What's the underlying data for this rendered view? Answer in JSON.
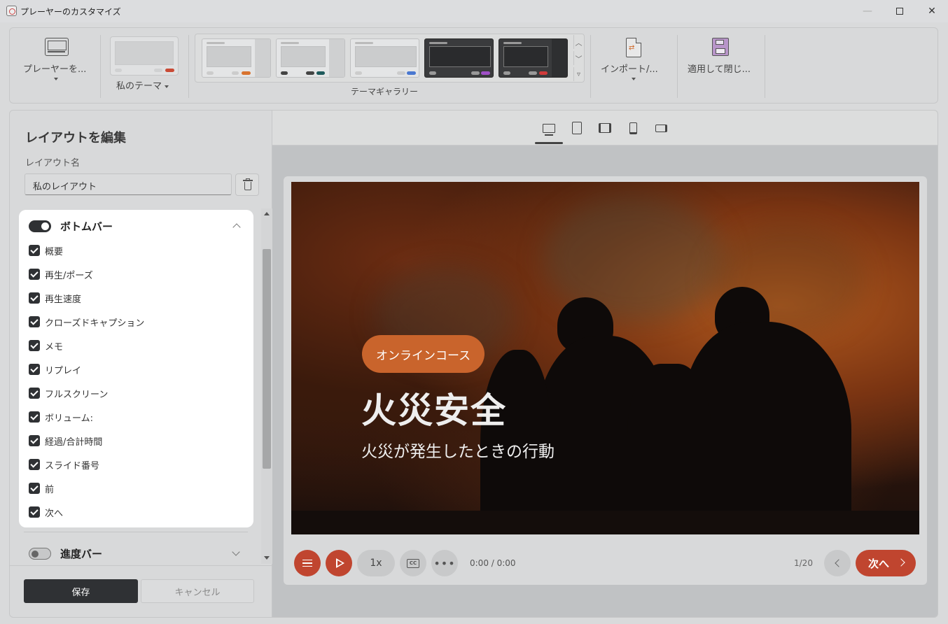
{
  "window": {
    "title": "プレーヤーのカスタマイズ"
  },
  "ribbon": {
    "player_label": "プレーヤーを...",
    "my_theme_label": "私のテーマ",
    "gallery_label": "テーマギャラリー",
    "import_label": "インポート/...",
    "apply_close_label": "適用して閉じ..."
  },
  "left_panel": {
    "title": "レイアウトを編集",
    "layout_name_label": "レイアウト名",
    "layout_name_value": "私のレイアウト",
    "bottom_bar": {
      "title": "ボトムバー",
      "enabled": true,
      "items": [
        {
          "label": "概要",
          "checked": true
        },
        {
          "label": "再生/ポーズ",
          "checked": true
        },
        {
          "label": "再生速度",
          "checked": true
        },
        {
          "label": "クローズドキャプション",
          "checked": true
        },
        {
          "label": "メモ",
          "checked": true
        },
        {
          "label": "リプレイ",
          "checked": true
        },
        {
          "label": "フルスクリーン",
          "checked": true
        },
        {
          "label": "ボリューム:",
          "checked": true
        },
        {
          "label": "経過/合計時間",
          "checked": true
        },
        {
          "label": "スライド番号",
          "checked": true
        },
        {
          "label": "前",
          "checked": true
        },
        {
          "label": "次へ",
          "checked": true
        }
      ]
    },
    "progress_bar": {
      "title": "進度バー",
      "enabled": false
    },
    "save_label": "保存",
    "cancel_label": "キャンセル"
  },
  "preview": {
    "slide": {
      "tag": "オンラインコース",
      "title": "火災安全",
      "subtitle": "火災が発生したときの行動"
    },
    "controls": {
      "speed": "1x",
      "cc": "CC",
      "more": "•••",
      "time": "0:00 / 0:00",
      "slide_number": "1/20",
      "next_label": "次へ"
    }
  },
  "colors": {
    "accent": "#c0452f",
    "tag": "#c9642c",
    "dark": "#2f3134"
  }
}
